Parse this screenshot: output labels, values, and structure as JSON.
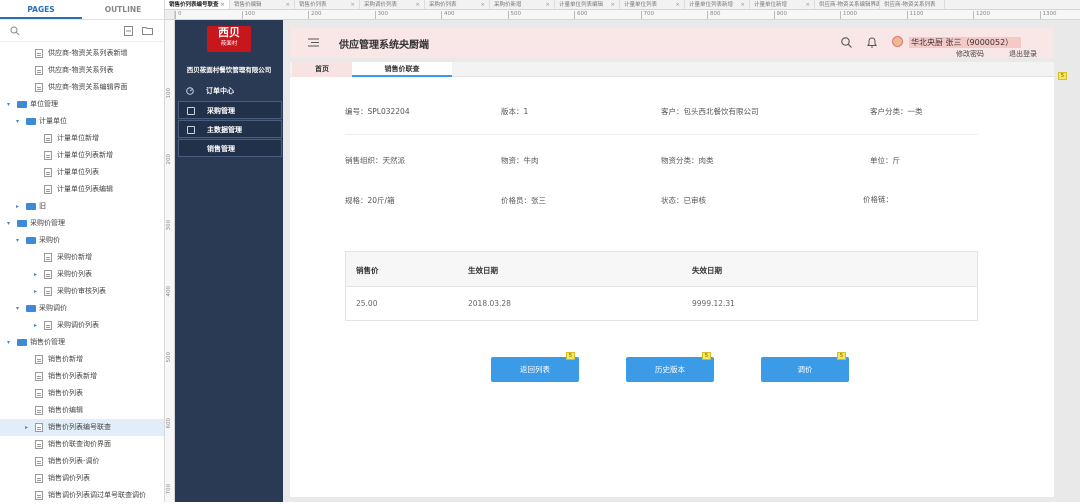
{
  "pages_panel": {
    "tabs": [
      "PAGES",
      "OUTLINE"
    ],
    "tree": [
      {
        "label": "供应商-物资关系列表新增",
        "type": "page",
        "indent": 3
      },
      {
        "label": "供应商-物资关系列表",
        "type": "page",
        "indent": 3
      },
      {
        "label": "供应商-物资关系编辑界面",
        "type": "page",
        "indent": 3
      },
      {
        "label": "单位管理",
        "type": "folder",
        "indent": 1,
        "caret": "▾"
      },
      {
        "label": "计量单位",
        "type": "folder",
        "indent": 2,
        "caret": "▾"
      },
      {
        "label": "计量单位新增",
        "type": "page",
        "indent": 4
      },
      {
        "label": "计量单位列表新增",
        "type": "page",
        "indent": 4
      },
      {
        "label": "计量单位列表",
        "type": "page",
        "indent": 4
      },
      {
        "label": "计量单位列表编辑",
        "type": "page",
        "indent": 4
      },
      {
        "label": "旧",
        "type": "folder",
        "indent": 2,
        "caret": "▸"
      },
      {
        "label": "采购价管理",
        "type": "folder",
        "indent": 1,
        "caret": "▾"
      },
      {
        "label": "采购价",
        "type": "folder",
        "indent": 2,
        "caret": "▾"
      },
      {
        "label": "采购价新增",
        "type": "page",
        "indent": 4
      },
      {
        "label": "采购价列表",
        "type": "page",
        "indent": 4,
        "caret": "▸"
      },
      {
        "label": "采购价审核列表",
        "type": "page",
        "indent": 4,
        "caret": "▸"
      },
      {
        "label": "采购调价",
        "type": "folder",
        "indent": 2,
        "caret": "▾"
      },
      {
        "label": "采购调价列表",
        "type": "page",
        "indent": 4,
        "caret": "▸"
      },
      {
        "label": "销售价管理",
        "type": "folder",
        "indent": 1,
        "caret": "▾"
      },
      {
        "label": "销售价新增",
        "type": "page",
        "indent": 3
      },
      {
        "label": "销售价列表新增",
        "type": "page",
        "indent": 3
      },
      {
        "label": "销售价列表",
        "type": "page",
        "indent": 3
      },
      {
        "label": "销售价编辑",
        "type": "page",
        "indent": 3
      },
      {
        "label": "销售价列表编号联查",
        "type": "page",
        "indent": 3,
        "caret": "▸",
        "selected": true
      },
      {
        "label": "销售价联查询价界面",
        "type": "page",
        "indent": 3
      },
      {
        "label": "销售价列表-调价",
        "type": "page",
        "indent": 3
      },
      {
        "label": "销售调价列表",
        "type": "page",
        "indent": 3
      },
      {
        "label": "销售调价列表调过单号联查调价",
        "type": "page",
        "indent": 3
      }
    ]
  },
  "doc_tabs": [
    "销售价列表编号联查",
    "销售价编辑",
    "销售价列表",
    "采购调价列表",
    "采购价列表",
    "采购价新增",
    "计量单位列表编辑",
    "计量单位列表",
    "计量单位列表新增",
    "计量单位新增",
    "供应商-物资关系编辑界面",
    "供应商-物资关系列表"
  ],
  "ruler": {
    "h": [
      "0",
      "100",
      "200",
      "300",
      "400",
      "500",
      "600",
      "700",
      "800",
      "900",
      "1000",
      "1100",
      "1200",
      "1300",
      "1400"
    ],
    "v": [
      "100",
      "200",
      "300",
      "400",
      "500",
      "600",
      "700"
    ]
  },
  "app": {
    "logo_main": "西贝",
    "logo_sub": "莜面村",
    "company": "西贝莜面村餐饮管理有限公司",
    "nav": [
      "订单中心",
      "采购管理",
      "主数据管理",
      "销售管理"
    ],
    "title": "供应管理系统央厨端",
    "user": "华北央厨 张三（9000052）",
    "change_pwd": "修改密码",
    "logout": "退出登录",
    "tabs": [
      "首页",
      "销售价联查"
    ],
    "fields": {
      "code": "编号：SPL032204",
      "version": "版本：1",
      "customer": "客户：包头西北餐饮有限公司",
      "customer_type": "客户分类：一类",
      "sales_org": "销售组织：天然派",
      "material": "物资：牛肉",
      "material_type": "物资分类：肉类",
      "unit": "单位：斤",
      "spec": "规格：20斤/箱",
      "pricer": "价格员：张三",
      "status": "状态：已审核",
      "price_chain": "价格链："
    },
    "table": {
      "headers": [
        "销售价",
        "生效日期",
        "失效日期"
      ],
      "row": [
        "25.00",
        "2018.03.28",
        "9999.12.31"
      ]
    },
    "buttons": [
      "返回列表",
      "历史版本",
      "调价"
    ],
    "note_badge": "5"
  }
}
